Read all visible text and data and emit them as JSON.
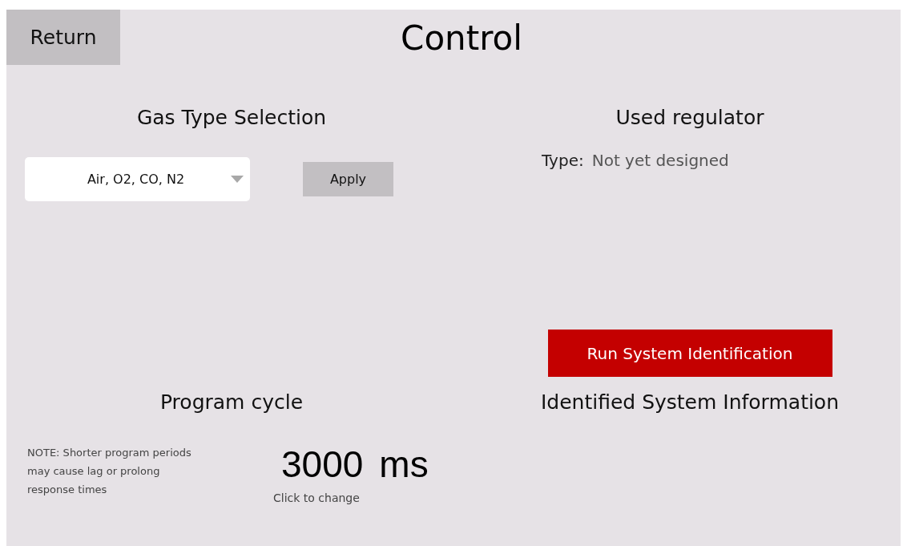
{
  "header": {
    "return_button": "Return",
    "title": "Control"
  },
  "gas_type": {
    "heading": "Gas Type Selection",
    "dropdown": {
      "value": "Air, O2, CO, N2"
    },
    "apply_button": "Apply"
  },
  "regulator": {
    "heading": "Used regulator",
    "type_label": "Type:",
    "type_value": "Not yet designed",
    "run_button": "Run System Identification"
  },
  "program_cycle": {
    "heading": "Program cycle",
    "note": "NOTE: Shorter program periods may cause lag or prolong response times",
    "value": "3000",
    "unit": "ms",
    "hint": "Click to change"
  },
  "identified": {
    "heading": "Identified System Information"
  }
}
